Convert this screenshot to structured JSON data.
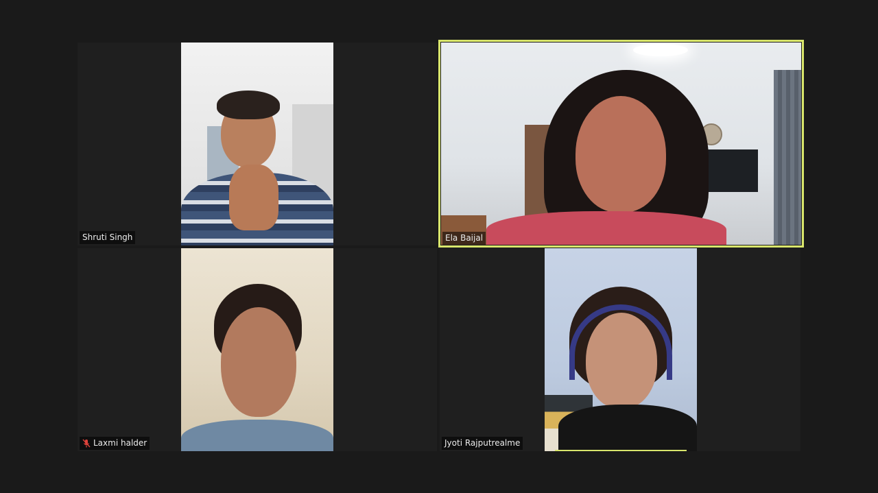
{
  "meeting": {
    "participants": [
      {
        "name": "Shruti Singh",
        "muted": false,
        "speaking": false
      },
      {
        "name": "Ela Baijal",
        "muted": false,
        "speaking": true
      },
      {
        "name": "Laxmi halder",
        "muted": true,
        "speaking": false
      },
      {
        "name": "Jyoti Rajputrealme",
        "muted": false,
        "speaking": false
      }
    ]
  },
  "colors": {
    "background": "#1a1a1a",
    "tile": "#1f1f1f",
    "active_speaker": "#d9e66c",
    "mute_icon": "#e0433b"
  },
  "icons": {
    "muted": "mic-off-icon"
  }
}
